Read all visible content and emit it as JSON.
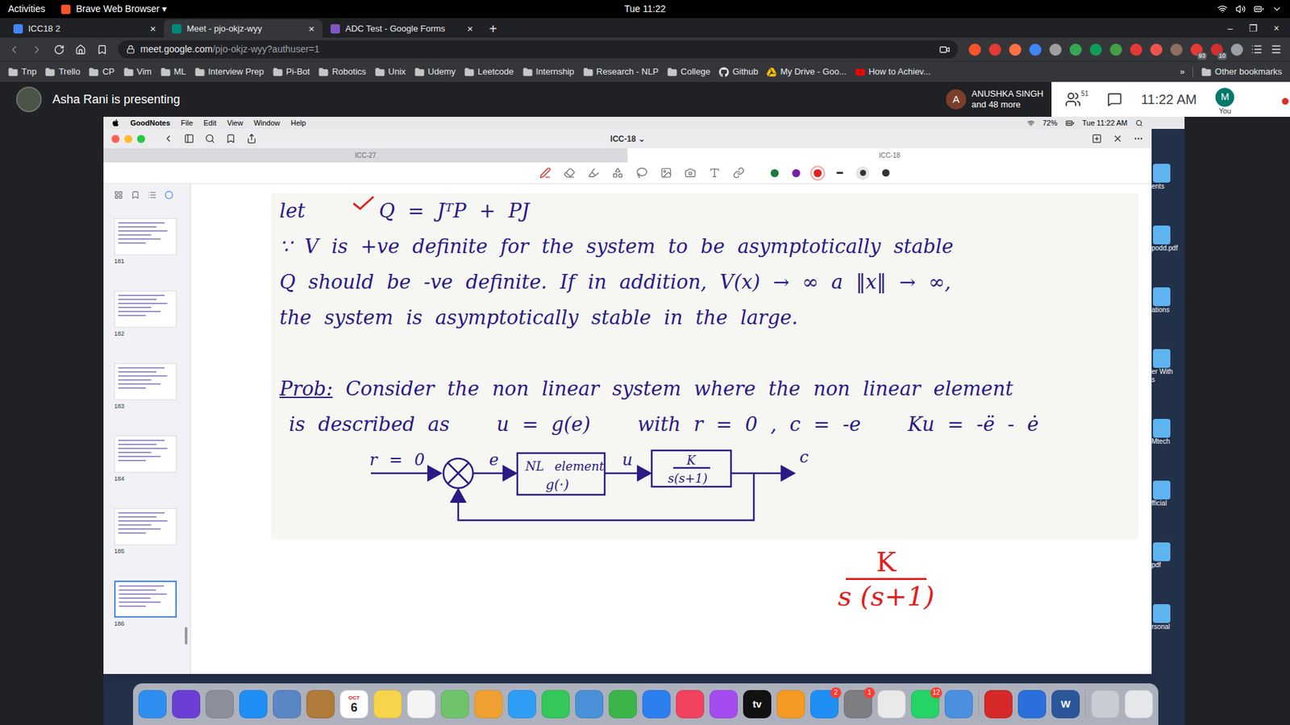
{
  "system_bar": {
    "activities": "Activities",
    "app": "Brave Web Browser ▾",
    "clock": "Tue 11:22"
  },
  "browser": {
    "tabs": [
      {
        "label": "ICC18 2",
        "selected": false,
        "color": "#4285f4"
      },
      {
        "label": "Meet - pjo-okjz-wyy",
        "selected": true,
        "color": "#00897b"
      },
      {
        "label": "ADC Test - Google Forms",
        "selected": false,
        "color": "#7e57c2"
      }
    ],
    "tab_close": "×",
    "new_tab": "+",
    "window_controls": [
      "–",
      "❐",
      "×"
    ],
    "url_host": "meet.google.com",
    "url_path": "/pjo-okjz-wyy?authuser=1",
    "extensions": [
      {
        "color": "#fb542b",
        "badge": ""
      },
      {
        "color": "#e53935",
        "badge": ""
      },
      {
        "color": "#ff7043",
        "badge": ""
      },
      {
        "color": "#4285f4",
        "badge": ""
      },
      {
        "color": "#9e9e9e",
        "badge": ""
      },
      {
        "color": "#34a853",
        "badge": ""
      },
      {
        "color": "#0f9d58",
        "badge": ""
      },
      {
        "color": "#43a047",
        "badge": ""
      },
      {
        "color": "#e53935",
        "badge": ""
      },
      {
        "color": "#ef5350",
        "badge": ""
      },
      {
        "color": "#8d6e63",
        "badge": ""
      },
      {
        "color": "#e53935",
        "badge": "93"
      },
      {
        "color": "#d32f2f",
        "badge": "10"
      },
      {
        "color": "#9aa0a6",
        "badge": ""
      }
    ],
    "bookmarks": [
      {
        "label": "Tnp",
        "kind": "folder"
      },
      {
        "label": "Trello",
        "kind": "folder"
      },
      {
        "label": "CP",
        "kind": "folder"
      },
      {
        "label": "Vim",
        "kind": "folder"
      },
      {
        "label": "ML",
        "kind": "folder"
      },
      {
        "label": "Interview Prep",
        "kind": "folder"
      },
      {
        "label": "Pi-Bot",
        "kind": "folder"
      },
      {
        "label": "Robotics",
        "kind": "folder"
      },
      {
        "label": "Unix",
        "kind": "folder"
      },
      {
        "label": "Udemy",
        "kind": "folder"
      },
      {
        "label": "Leetcode",
        "kind": "folder"
      },
      {
        "label": "Internship",
        "kind": "folder"
      },
      {
        "label": "Research - NLP",
        "kind": "folder"
      },
      {
        "label": "College",
        "kind": "folder"
      },
      {
        "label": "Github",
        "kind": "github"
      },
      {
        "label": "My Drive - Goo...",
        "kind": "drive"
      },
      {
        "label": "How to Achiev...",
        "kind": "youtube"
      }
    ],
    "bookmarks_more": "»",
    "other_bookmarks": "Other bookmarks"
  },
  "meet": {
    "presenter_label": "Asha Rani is presenting",
    "participant_initial": "A",
    "participant_name": "ANUSHKA SINGH",
    "participant_more": "and 48 more",
    "people_count": "51",
    "time": "11:22 AM",
    "self_initial": "M",
    "self_label": "You"
  },
  "shared_screen": {
    "menu_bar": {
      "items": [
        "GoodNotes",
        "File",
        "Edit",
        "View",
        "Window",
        "Help"
      ],
      "battery": "72%",
      "clock": "Tue 11:22 AM"
    },
    "goodnotes": {
      "title": "ICC-18 ⌄",
      "doc_tabs": [
        {
          "label": "ICC-27",
          "selected": false
        },
        {
          "label": "ICC-18",
          "selected": true
        }
      ],
      "tools": [
        {
          "kind": "pen",
          "selected": true
        },
        {
          "kind": "eraser",
          "selected": false
        },
        {
          "kind": "highlighter",
          "selected": false
        },
        {
          "kind": "shapes",
          "selected": false
        },
        {
          "kind": "lasso",
          "selected": false
        },
        {
          "kind": "image",
          "selected": false
        },
        {
          "kind": "camera",
          "selected": false
        },
        {
          "kind": "text",
          "selected": false
        },
        {
          "kind": "link",
          "selected": false
        }
      ],
      "pen_colors": [
        {
          "color": "#1d7a3c",
          "selected": false
        },
        {
          "color": "#7b1fa2",
          "selected": false
        },
        {
          "color": "#e02424",
          "selected": true
        }
      ],
      "pen_widths": [
        {
          "selected": false
        },
        {
          "selected": true
        },
        {
          "selected": false
        }
      ],
      "pages": [
        {
          "label": "181",
          "selected": false
        },
        {
          "label": "182",
          "selected": false
        },
        {
          "label": "183",
          "selected": false
        },
        {
          "label": "184",
          "selected": false
        },
        {
          "label": "185",
          "selected": false
        },
        {
          "label": "186",
          "selected": true
        }
      ],
      "notes": {
        "line1_lead": "let",
        "line1_eq": "Q = JᵀP + PJ",
        "lines": [
          "∵ V is +ve definite for the system to be asymptotically stable",
          "Q should be -ve definite. If in addition, V(x) → ∞ a ‖x‖ → ∞,",
          "the system is asymptotically stable in the large."
        ],
        "problem_label": "Prob:",
        "problem_text": "Consider the non linear system where the non linear element",
        "problem_line2": [
          "is described as",
          "u = g(e)",
          "with r = 0 , c = -e",
          "Ku = -ë - ė"
        ]
      },
      "diagram": {
        "input": "r = 0",
        "error": "e",
        "block1_line1": "NL element",
        "block1_line2": "g(·)",
        "signal": "u",
        "block2_num": "K",
        "block2_den": "s(s+1)",
        "output": "c"
      },
      "red_annotation": {
        "numerator": "K",
        "denominator": "s (s+1)",
        "color": "#e02020"
      }
    },
    "desktop_icons": [
      {
        "lines": [
          "ents"
        ]
      },
      {
        "lines": [
          "podd.pdf"
        ]
      },
      {
        "lines": [
          "ations"
        ]
      },
      {
        "lines": [
          "er With",
          "s"
        ]
      },
      {
        "lines": [
          "Mtech"
        ]
      },
      {
        "lines": [
          "fficial"
        ]
      },
      {
        "lines": [
          "pdf"
        ]
      },
      {
        "lines": [
          "rsonal"
        ]
      }
    ],
    "dock": [
      {
        "kind": "app",
        "color": "#2f8ef0",
        "top": "",
        "text": "",
        "badge": ""
      },
      {
        "kind": "app",
        "color": "#6b3fd4",
        "top": "",
        "text": "",
        "badge": ""
      },
      {
        "kind": "app",
        "color": "#8a8f99",
        "top": "",
        "text": "",
        "badge": ""
      },
      {
        "kind": "app",
        "color": "#1f8ff5",
        "top": "",
        "text": "",
        "badge": ""
      },
      {
        "kind": "app",
        "color": "#5a86c4",
        "top": "",
        "text": "",
        "badge": ""
      },
      {
        "kind": "app",
        "color": "#b07a3a",
        "top": "",
        "text": "",
        "badge": ""
      },
      {
        "kind": "app",
        "color": "#ffffff",
        "top": "OCT",
        "text": "6",
        "badge": ""
      },
      {
        "kind": "app",
        "color": "#f7d54a",
        "top": "",
        "text": "",
        "badge": ""
      },
      {
        "kind": "app",
        "color": "#f4f4f4",
        "top": "",
        "text": "",
        "badge": ""
      },
      {
        "kind": "app",
        "color": "#6ec36b",
        "top": "",
        "text": "",
        "badge": ""
      },
      {
        "kind": "app",
        "color": "#f0a030",
        "top": "",
        "text": "",
        "badge": ""
      },
      {
        "kind": "app",
        "color": "#2f9cf5",
        "top": "",
        "text": "",
        "badge": ""
      },
      {
        "kind": "app",
        "color": "#35c759",
        "top": "",
        "text": "",
        "badge": ""
      },
      {
        "kind": "app",
        "color": "#4a90d9",
        "top": "",
        "text": "",
        "badge": ""
      },
      {
        "kind": "app",
        "color": "#3bb54a",
        "top": "",
        "text": "",
        "badge": ""
      },
      {
        "kind": "app",
        "color": "#2d7ff0",
        "top": "",
        "text": "",
        "badge": ""
      },
      {
        "kind": "app",
        "color": "#f3425f",
        "top": "",
        "text": "",
        "badge": ""
      },
      {
        "kind": "app",
        "color": "#a44cf0",
        "top": "",
        "text": "",
        "badge": ""
      },
      {
        "kind": "app",
        "color": "#111111",
        "top": "",
        "text": "tv",
        "badge": ""
      },
      {
        "kind": "app",
        "color": "#f59a23",
        "top": "",
        "text": "",
        "badge": ""
      },
      {
        "kind": "app",
        "color": "#1f8ff5",
        "top": "",
        "text": "",
        "badge": "2"
      },
      {
        "kind": "app",
        "color": "#7d7d82",
        "top": "",
        "text": "",
        "badge": "1"
      },
      {
        "kind": "app",
        "color": "#e9e9e9",
        "top": "",
        "text": "",
        "badge": ""
      },
      {
        "kind": "app",
        "color": "#25d366",
        "top": "",
        "text": "",
        "badge": "12"
      },
      {
        "kind": "app",
        "color": "#4a8fe0",
        "top": "",
        "text": "",
        "badge": ""
      },
      {
        "kind": "separator",
        "color": "#9a9a9a",
        "top": "",
        "text": "",
        "badge": ""
      },
      {
        "kind": "app",
        "color": "#d62828",
        "top": "",
        "text": "",
        "badge": ""
      },
      {
        "kind": "app",
        "color": "#2a6fdb",
        "top": "",
        "text": "",
        "badge": ""
      },
      {
        "kind": "app",
        "color": "#2b579a",
        "top": "",
        "text": "W",
        "badge": ""
      },
      {
        "kind": "separator",
        "color": "#9a9a9a",
        "top": "",
        "text": "",
        "badge": ""
      },
      {
        "kind": "app",
        "color": "#c9ccd3",
        "top": "",
        "text": "",
        "badge": ""
      },
      {
        "kind": "app",
        "color": "#e6e7ea",
        "top": "",
        "text": "",
        "badge": ""
      }
    ]
  }
}
